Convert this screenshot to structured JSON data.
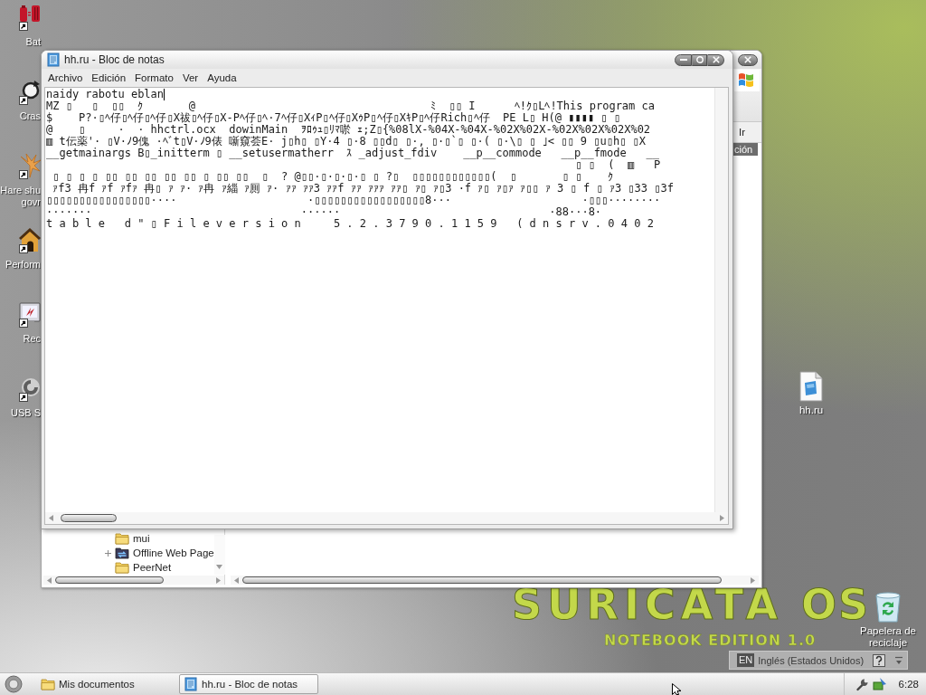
{
  "desktop": {
    "icons_left": [
      {
        "label": "Bat",
        "kind": "battery"
      },
      {
        "label": "Cras",
        "kind": "disc"
      },
      {
        "label": "Hare shu\ngovr",
        "kind": "hare"
      },
      {
        "label": "Perform",
        "kind": "doghouse"
      },
      {
        "label": "Rec",
        "kind": "monitor"
      },
      {
        "label": "USB S",
        "kind": "swirl"
      }
    ],
    "icons_right": [
      {
        "label": "hh.ru",
        "kind": "text_file"
      },
      {
        "label": "Papelera de reciclaje",
        "kind": "recycle_bin"
      }
    ],
    "wallpaper": {
      "logo": "SURICATA",
      "logo_suffix": "OS",
      "edition": "NOTEBOOK EDITION 1.0"
    }
  },
  "explorer_window": {
    "go_button": "Ir",
    "column_header": "ción",
    "tree": [
      {
        "label": "mui",
        "kind": "folder",
        "expandable": false
      },
      {
        "label": "Offline Web Page",
        "kind": "sync_folder",
        "expandable": true
      },
      {
        "label": "PeerNet",
        "kind": "folder",
        "expandable": false
      }
    ]
  },
  "notepad_window": {
    "title": "hh.ru - Bloc de notas",
    "menu": [
      "Archivo",
      "Edición",
      "Formato",
      "Ver",
      "Ayuda"
    ],
    "lines": [
      {
        "text": "naidy rabotu eblan",
        "caret": true
      },
      {
        "text": "MZ ▯   ▯  ▯▯  ｸ       @                                    ﾐ  ▯▯ I      ﾍ!ｸ▯Lﾍ!This program ca",
        "caret": false
      },
      {
        "text": "$    P?·▯ﾍ仔▯ﾍ仔▯ﾍ仔▯X祓▯ﾍ仔▯X-Pﾍ仔▯ﾍ·7ﾍ仔▯XｨP▯ﾍ仔▯XｩP▯ﾍ仔▯XｷP▯ﾍ仔Rich▯ﾍ仔  PE L▯ H(@ ▮▮▮▮ ▯ ▯",
        "caret": false
      },
      {
        "text": "@    ▯     ·  · hhctrl.ocx  dowinMain  ｦﾛｩｭ▯ﾘﾏ唹 ｪ;Z▯{%08lX-%04X-%04X-%02X%02X-%02X%02X%02X%02",
        "caret": false
      },
      {
        "text": "▥ t伝薬'· ▯V·ﾉ9傀 ·ﾍﾞt▯V·ﾉ9俵 噺窺荟E· j▯h▯ ▯Y·4 ▯·8 ▯▯d▯ ▯·, ▯·▯`▯ ▯·( ▯·\\▯ ▯ ｣< ▯▯ 9 ▯u▯h▯ ▯X",
        "caret": false
      },
      {
        "text": "__getmainargs B▯_initterm ▯ __setusermatherr  ｽ _adjust_fdiv    __p__commode   __p__fmode   __",
        "caret": false
      },
      {
        "text": "                                                                                 ▯ ▯  (  ▥   P",
        "caret": false
      },
      {
        "text": " ▯ ▯ ▯ ▯ ▯▯ ▯▯ ▯▯ ▯▯ ▯▯ ▯ ▯▯ ▯▯  ▯  ? @▯▯·▯·▯·▯·▯ ▯ ?▯  ▯▯▯▯▯▯▯▯▯▯▯▯(  ▯       ▯ ▯    ｸ",
        "caret": false
      },
      {
        "text": " ｧf3 冉f ｧf ｧfｧ 冉▯ ｧ ｧ· ｧ冉 ｧ緇 ｧ厠 ｧ· ｧｧ ｧｧ3 ｧｧf ｧｧ ｧｧｧ ｧｧ▯ ｧ▯ ｧ▯3 ·f ｧ▯ ｧ▯ｧ ｧ▯▯ ｧ 3 ▯ f ▯ ｧ3 ▯33 ▯3f",
        "caret": false
      },
      {
        "text": "▯▯▯▯▯▯▯▯▯▯▯▯▯▯▯▯····                    ·▯▯▯▯▯▯▯▯▯▯▯▯▯▯▯▯▯8···                    ·▯▯▯········",
        "caret": false
      },
      {
        "text": "·······                                ······                                ·88···8·",
        "caret": false
      },
      {
        "text": "t a b l e   d \" ▯ F i l e v e r s i o n     5 . 2 . 3 7 9 0 . 1 1 5 9   ( d n s r v . 0 4 0 2",
        "caret": false
      }
    ]
  },
  "language_bar": {
    "code": "EN",
    "language": "Inglés (Estados Unidos)"
  },
  "taskbar": {
    "buttons": [
      {
        "label": "Mis documentos",
        "kind": "folder",
        "selected": false
      },
      {
        "label": "hh.ru - Bloc de notas",
        "kind": "notepad",
        "selected": true
      }
    ],
    "clock": "6:28"
  }
}
